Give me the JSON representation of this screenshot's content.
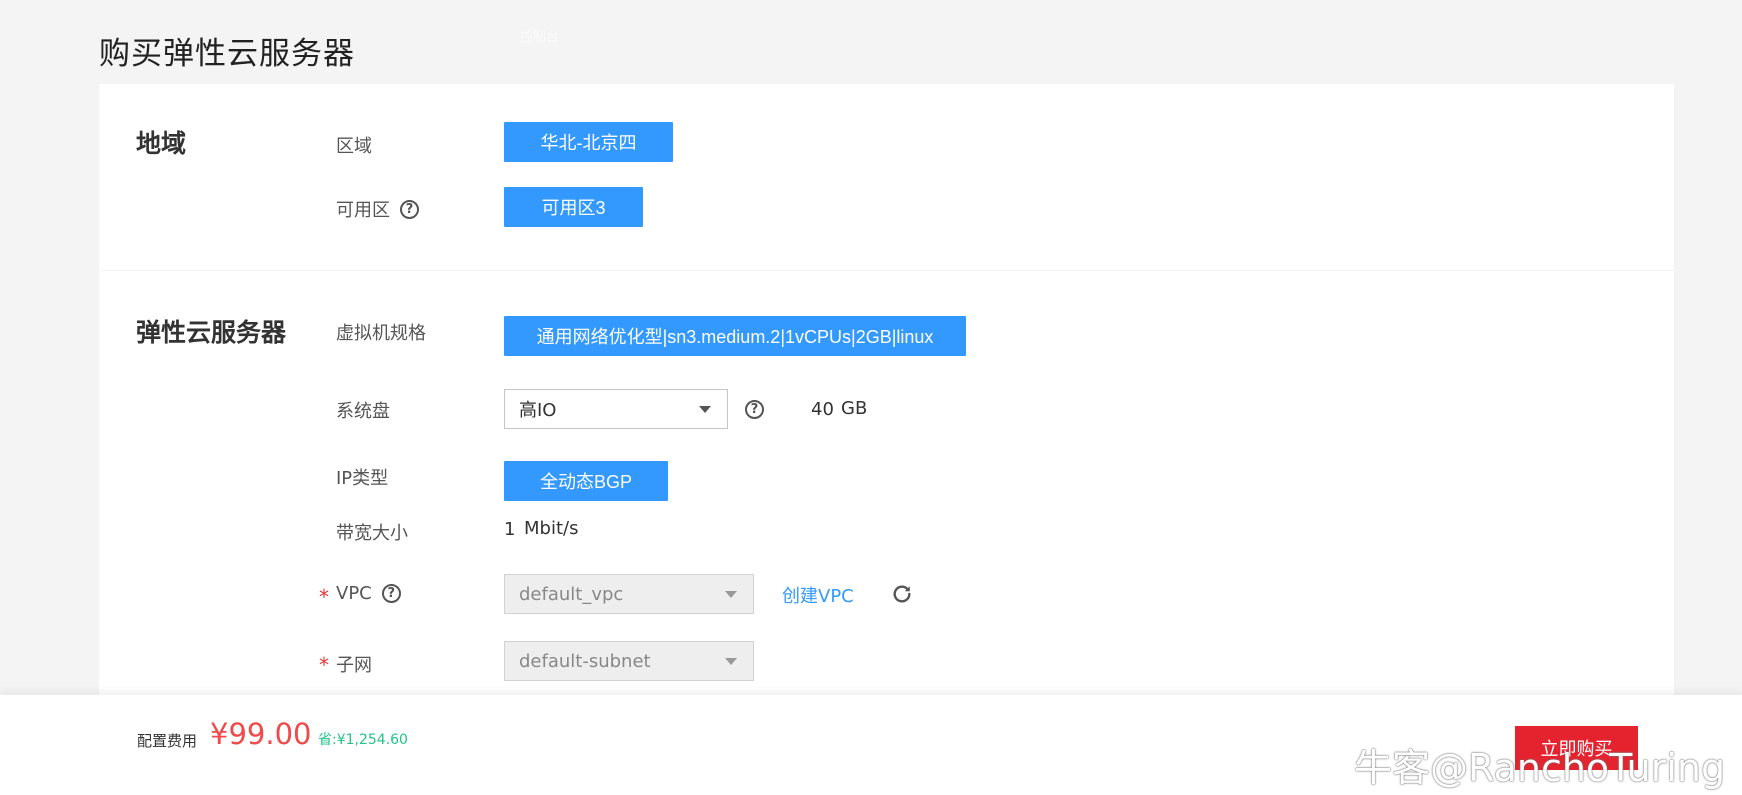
{
  "header": {
    "title": "购买弹性云服务器",
    "console_link": "控制台"
  },
  "region_section": {
    "title": "地域",
    "region_label": "区域",
    "region_value": "华北-北京四",
    "az_label": "可用区",
    "az_value": "可用区3"
  },
  "ecs_section": {
    "title": "弹性云服务器",
    "flavor_label": "虚拟机规格",
    "flavor_value": "通用网络优化型|sn3.medium.2|1vCPUs|2GB|linux",
    "disk_label": "系统盘",
    "disk_type": "高IO",
    "disk_size": "40",
    "disk_unit": "GB",
    "ip_label": "IP类型",
    "ip_value": "全动态BGP",
    "bandwidth_label": "带宽大小",
    "bandwidth_value": "1",
    "bandwidth_unit": "Mbit/s",
    "vpc_label": "VPC",
    "vpc_value": "default_vpc",
    "create_vpc_link": "创建VPC",
    "subnet_label": "子网",
    "subnet_value": "default-subnet",
    "required_mark": "*"
  },
  "footer": {
    "fee_label": "配置费用",
    "price": "¥99.00",
    "save": "省:¥1,254.60",
    "buy_label": "立即购买"
  },
  "watermark": {
    "text": "牛客@RanchoTuring"
  },
  "icons": {
    "help": "?",
    "refresh": "refresh-icon",
    "dropdown": "chevron-down-icon"
  },
  "colors": {
    "primary": "#3399ff",
    "buy": "#e4232f",
    "price": "#f04a4a",
    "save": "#22c48a"
  }
}
